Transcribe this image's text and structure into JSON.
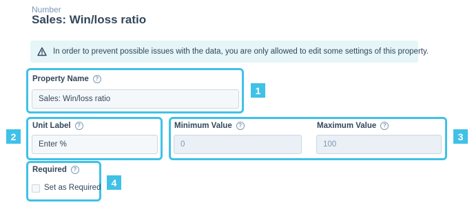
{
  "header": {
    "type_label": "Number",
    "title": "Sales: Win/loss ratio"
  },
  "alert": {
    "icon": "warning-triangle-icon",
    "message": "In order to prevent possible issues with the data, you are only allowed to edit some settings of this property."
  },
  "fields": {
    "property_name": {
      "label": "Property Name",
      "value": "Sales: Win/loss ratio"
    },
    "unit_label": {
      "label": "Unit Label",
      "value": "Enter %"
    },
    "minimum_value": {
      "label": "Minimum Value",
      "value": "0"
    },
    "maximum_value": {
      "label": "Maximum Value",
      "value": "100"
    },
    "required": {
      "label": "Required",
      "checkbox_label": "Set as Required",
      "checked": false
    }
  },
  "help_icon_glyph": "?",
  "callouts": {
    "one": "1",
    "two": "2",
    "three": "3",
    "four": "4"
  },
  "colors": {
    "highlight": "#3fc1e8",
    "alert_background": "#e5f5f8",
    "text": "#33475b",
    "muted": "#7c98b6"
  }
}
